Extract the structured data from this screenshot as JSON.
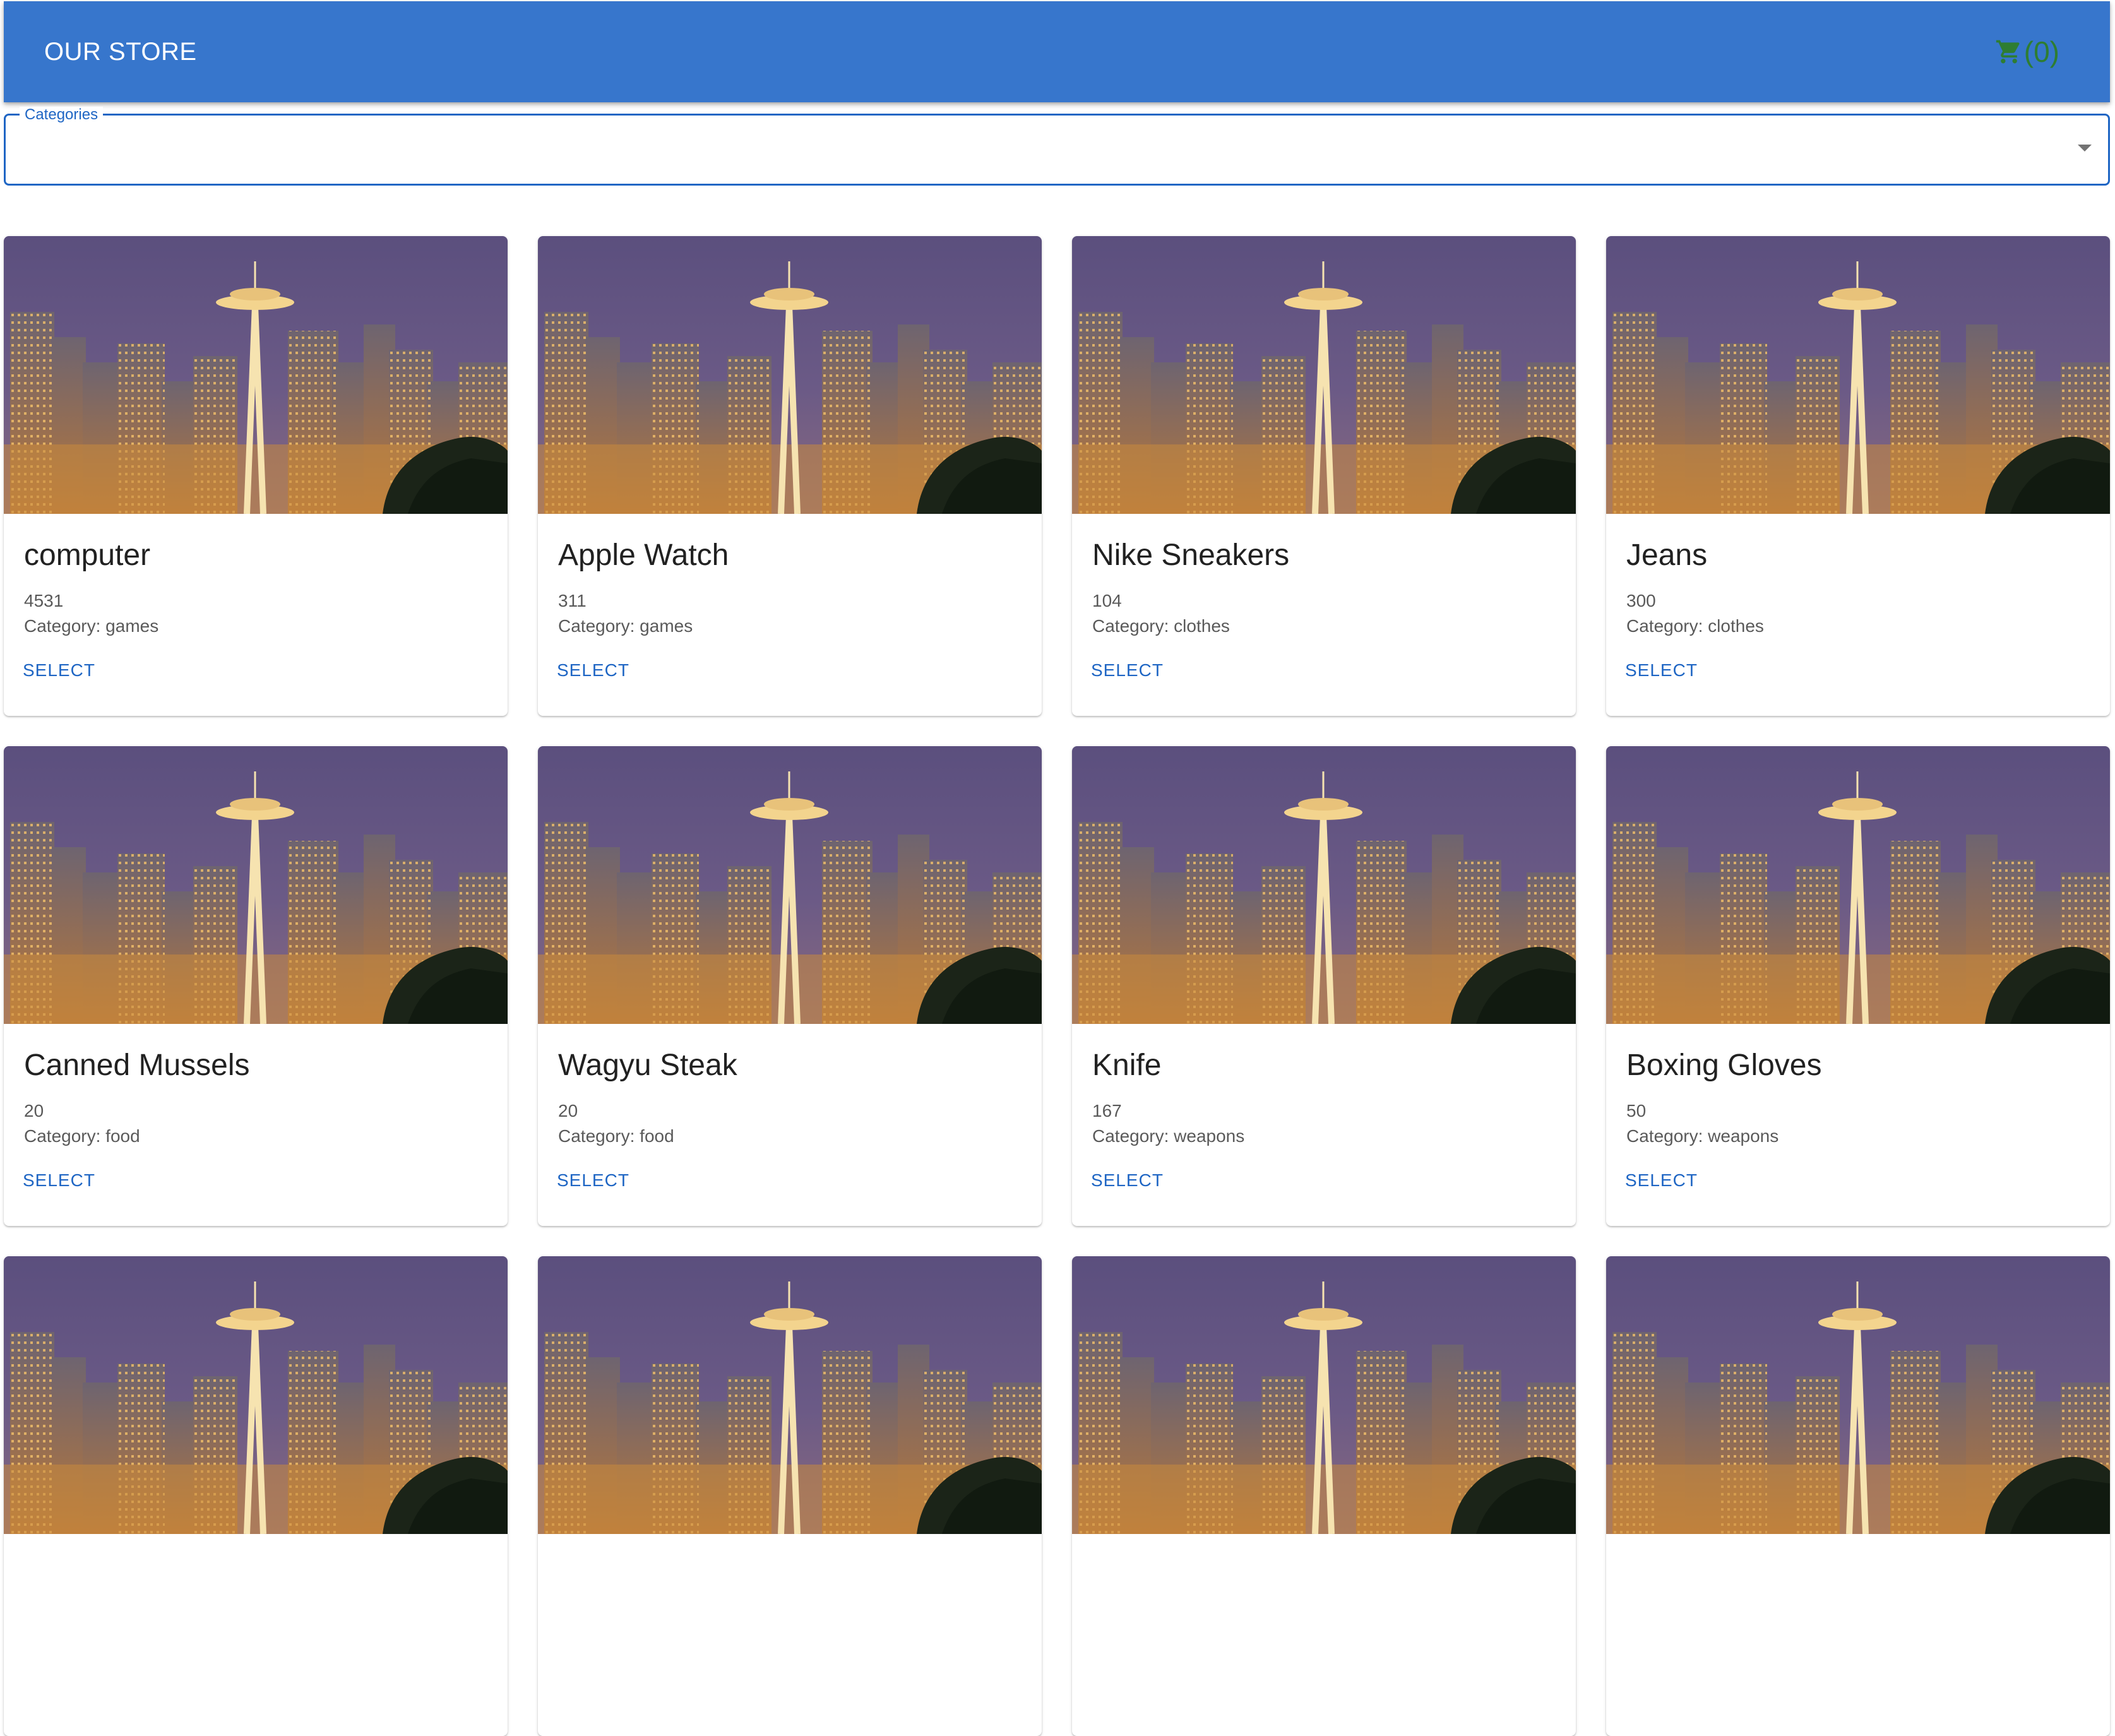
{
  "header": {
    "title": "OUR STORE",
    "cart_count": "(0)",
    "cart_color": "#2e7d32",
    "background": "#3776cc"
  },
  "filter": {
    "label": "Categories",
    "value": ""
  },
  "products": [
    {
      "name": "computer",
      "price": "4531",
      "category": "Category: games",
      "action": "SELECT"
    },
    {
      "name": "Apple Watch",
      "price": "311",
      "category": "Category: games",
      "action": "SELECT"
    },
    {
      "name": "Nike Sneakers",
      "price": "104",
      "category": "Category: clothes",
      "action": "SELECT"
    },
    {
      "name": "Jeans",
      "price": "300",
      "category": "Category: clothes",
      "action": "SELECT"
    },
    {
      "name": "Canned Mussels",
      "price": "20",
      "category": "Category: food",
      "action": "SELECT"
    },
    {
      "name": "Wagyu Steak",
      "price": "20",
      "category": "Category: food",
      "action": "SELECT"
    },
    {
      "name": "Knife",
      "price": "167",
      "category": "Category: weapons",
      "action": "SELECT"
    },
    {
      "name": "Boxing Gloves",
      "price": "50",
      "category": "Category: weapons",
      "action": "SELECT"
    },
    {
      "name": "",
      "price": "",
      "category": "",
      "action": ""
    },
    {
      "name": "",
      "price": "",
      "category": "",
      "action": ""
    },
    {
      "name": "",
      "price": "",
      "category": "",
      "action": ""
    },
    {
      "name": "",
      "price": "",
      "category": "",
      "action": ""
    }
  ]
}
